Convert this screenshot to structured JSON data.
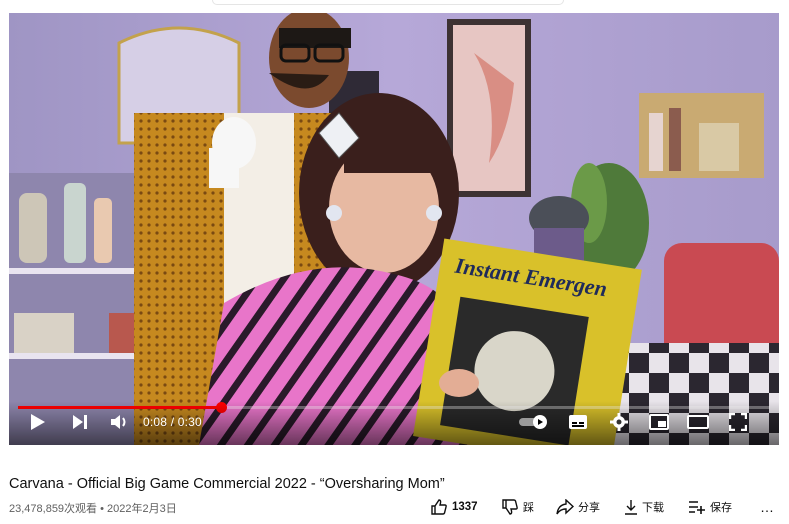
{
  "player": {
    "current_time": "0:08",
    "duration": "0:30",
    "time_display": "0:08 / 0:30",
    "progress_fraction": 0.27,
    "album_text": "Instant Emergen"
  },
  "video": {
    "title": "Carvana - Official Big Game Commercial 2022 - “Oversharing Mom”",
    "views": "23,478,859次观看",
    "separator": "•",
    "date": "2022年2月3日"
  },
  "actions": {
    "like_count": "1337",
    "dislike_label": "踩",
    "share_label": "分享",
    "download_label": "下载",
    "save_label": "保存",
    "more_label": "…"
  },
  "colors": {
    "accent": "#ff0000",
    "wall": "#b9a9d6",
    "cape_pink": "#e26bc4",
    "album_yellow": "#d9c12a"
  },
  "icons": [
    "play-icon",
    "next-icon",
    "volume-icon",
    "autoplay-toggle-icon",
    "subtitles-icon",
    "settings-gear-icon",
    "miniplayer-icon",
    "theater-mode-icon",
    "fullscreen-icon",
    "thumbs-up-icon",
    "thumbs-down-icon",
    "share-icon",
    "download-icon",
    "save-playlist-icon",
    "more-icon"
  ]
}
